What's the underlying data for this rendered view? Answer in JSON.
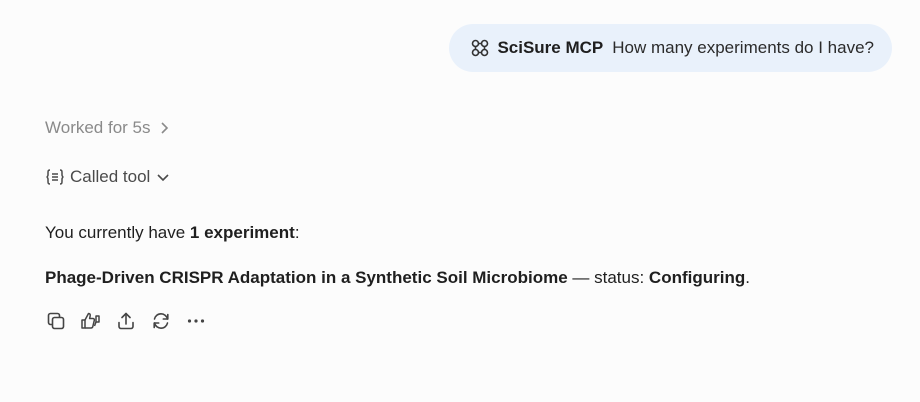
{
  "user_message": {
    "tool_name": "SciSure MCP",
    "text": "How many experiments do I have?"
  },
  "worked": {
    "label": "Worked for 5s"
  },
  "tool_call": {
    "label": "Called tool"
  },
  "answer": {
    "line1_prefix": "You currently have ",
    "line1_bold": "1 experiment",
    "line1_suffix": ":",
    "experiment_name": "Phage-Driven CRISPR Adaptation in a Synthetic Soil Microbiome",
    "status_prefix": " — status: ",
    "status_value": "Configuring",
    "status_suffix": "."
  },
  "actions": {
    "icons": [
      "copy-icon",
      "thumbs-feedback-icon",
      "share-icon",
      "regenerate-icon",
      "more-icon"
    ]
  }
}
